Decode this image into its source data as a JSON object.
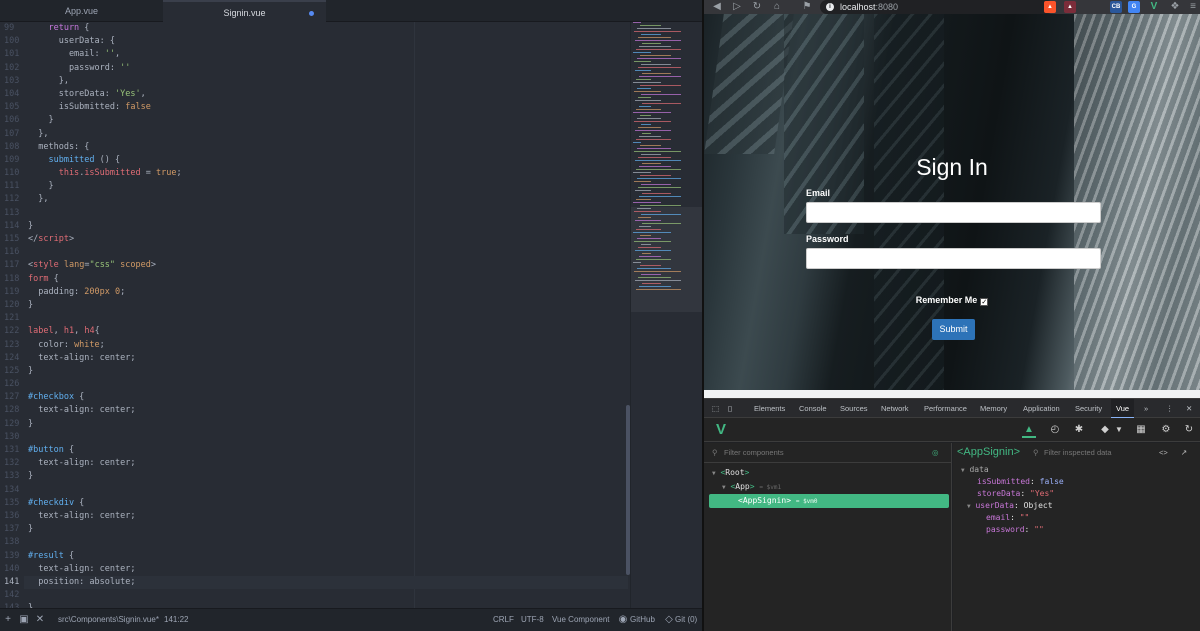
{
  "editor": {
    "tabs": [
      {
        "label": "App.vue"
      },
      {
        "label": "Signin.vue"
      }
    ],
    "line_numbers": [
      "99",
      "100",
      "101",
      "102",
      "103",
      "104",
      "105",
      "106",
      "107",
      "108",
      "109",
      "110",
      "111",
      "112",
      "113",
      "114",
      "115",
      "116",
      "117",
      "118",
      "119",
      "120",
      "121",
      "122",
      "123",
      "124",
      "125",
      "126",
      "127",
      "128",
      "129",
      "130",
      "131",
      "132",
      "133",
      "134",
      "135",
      "136",
      "137",
      "138",
      "139",
      "140",
      "141",
      "142",
      "143"
    ],
    "current_line": "141",
    "code_lines": [
      [
        [
          "kw",
          "    return"
        ],
        [
          "pl",
          " {"
        ]
      ],
      [
        [
          "pl",
          "      userData: {"
        ]
      ],
      [
        [
          "pl",
          "        email: "
        ],
        [
          "st",
          "''"
        ],
        [
          "pl",
          ","
        ]
      ],
      [
        [
          "pl",
          "        password: "
        ],
        [
          "st",
          "''"
        ]
      ],
      [
        [
          "pl",
          "      },"
        ]
      ],
      [
        [
          "pl",
          "      storeData: "
        ],
        [
          "st",
          "'Yes'"
        ],
        [
          "pl",
          ","
        ]
      ],
      [
        [
          "pl",
          "      isSubmitted: "
        ],
        [
          "nu",
          "false"
        ]
      ],
      [
        [
          "pl",
          "    }"
        ]
      ],
      [
        [
          "pl",
          "  },"
        ]
      ],
      [
        [
          "pl",
          "  methods: {"
        ]
      ],
      [
        [
          "fn",
          "    submitted"
        ],
        [
          "pl",
          " () {"
        ]
      ],
      [
        [
          "tg",
          "      this"
        ],
        [
          "pl",
          "."
        ],
        [
          "pr",
          "isSubmitted"
        ],
        [
          "pl",
          " = "
        ],
        [
          "nu",
          "true"
        ],
        [
          "pl",
          ";"
        ]
      ],
      [
        [
          "pl",
          "    }"
        ]
      ],
      [
        [
          "pl",
          "  },"
        ]
      ],
      [
        [
          "pl",
          ""
        ]
      ],
      [
        [
          "pl",
          "}"
        ]
      ],
      [
        [
          "pl",
          "</"
        ],
        [
          "tg",
          "script"
        ],
        [
          "pl",
          ">"
        ]
      ],
      [
        [
          "pl",
          ""
        ]
      ],
      [
        [
          "pl",
          "<"
        ],
        [
          "tg",
          "style"
        ],
        [
          "pl",
          " "
        ],
        [
          "at",
          "lang"
        ],
        [
          "pl",
          "="
        ],
        [
          "st",
          "\"css\""
        ],
        [
          "pl",
          " "
        ],
        [
          "at",
          "scoped"
        ],
        [
          "pl",
          ">"
        ]
      ],
      [
        [
          "tg",
          "form"
        ],
        [
          "pl",
          " {"
        ]
      ],
      [
        [
          "pl",
          "  padding: "
        ],
        [
          "nu",
          "200px 0"
        ],
        [
          "pl",
          ";"
        ]
      ],
      [
        [
          "pl",
          "}"
        ]
      ],
      [
        [
          "pl",
          ""
        ]
      ],
      [
        [
          "tg",
          "label"
        ],
        [
          "pl",
          ", "
        ],
        [
          "tg",
          "h1"
        ],
        [
          "pl",
          ", "
        ],
        [
          "tg",
          "h4"
        ],
        [
          "pl",
          "{"
        ]
      ],
      [
        [
          "pl",
          "  color: "
        ],
        [
          "nu",
          "white"
        ],
        [
          "pl",
          ";"
        ]
      ],
      [
        [
          "pl",
          "  text-align: center;"
        ]
      ],
      [
        [
          "pl",
          "}"
        ]
      ],
      [
        [
          "pl",
          ""
        ]
      ],
      [
        [
          "id",
          "#checkbox"
        ],
        [
          "pl",
          " {"
        ]
      ],
      [
        [
          "pl",
          "  text-align: center;"
        ]
      ],
      [
        [
          "pl",
          "}"
        ]
      ],
      [
        [
          "pl",
          ""
        ]
      ],
      [
        [
          "id",
          "#button"
        ],
        [
          "pl",
          " {"
        ]
      ],
      [
        [
          "pl",
          "  text-align: center;"
        ]
      ],
      [
        [
          "pl",
          "}"
        ]
      ],
      [
        [
          "pl",
          ""
        ]
      ],
      [
        [
          "id",
          "#checkdiv"
        ],
        [
          "pl",
          " {"
        ]
      ],
      [
        [
          "pl",
          "  text-align: center;"
        ]
      ],
      [
        [
          "pl",
          "}"
        ]
      ],
      [
        [
          "pl",
          ""
        ]
      ],
      [
        [
          "id",
          "#result"
        ],
        [
          "pl",
          " {"
        ]
      ],
      [
        [
          "pl",
          "  text-align: center;"
        ]
      ],
      [
        [
          "pl",
          "  position: absolute;"
        ]
      ],
      [
        [
          "pl",
          ""
        ]
      ],
      [
        [
          "pl",
          "}"
        ]
      ]
    ]
  },
  "statusbar": {
    "file_path": "src\\Components\\Signin.vue*",
    "cursor": "141:22",
    "line_ending": "CRLF",
    "encoding": "UTF-8",
    "grammar": "Vue Component",
    "github": "GitHub",
    "git": "Git (0)"
  },
  "browser": {
    "url_host": "localhost",
    "url_port": ":8080",
    "extensions": [
      "CB",
      "G"
    ],
    "page": {
      "title": "Sign In",
      "email_label": "Email",
      "password_label": "Password",
      "remember_label": "Remember Me",
      "remember_checked": "✓",
      "submit_label": "Submit"
    }
  },
  "devtools": {
    "tabs": [
      "Elements",
      "Console",
      "Sources",
      "Network",
      "Performance",
      "Memory",
      "Application",
      "Security",
      "Vue"
    ],
    "active_tab": "Vue",
    "more": "»",
    "vue": {
      "filter_components_placeholder": "Filter components",
      "filter_inspected_placeholder": "Filter inspected data",
      "selected_component": "<AppSignin>",
      "tree": {
        "root": "Root",
        "app": "App",
        "app_hint": "= $vm1",
        "signin": "AppSignin",
        "signin_hint": "= $vm0"
      },
      "data_section": "data",
      "props": [
        {
          "key": "isSubmitted",
          "value": "false",
          "kind": "bool"
        },
        {
          "key": "storeData",
          "value": "\"Yes\"",
          "kind": "str"
        },
        {
          "key": "userData",
          "value": "Object",
          "kind": "obj"
        },
        {
          "key": "email",
          "value": "\"\"",
          "kind": "str"
        },
        {
          "key": "password",
          "value": "\"\"",
          "kind": "str"
        }
      ]
    }
  },
  "colors": {
    "vue_green": "#42b883",
    "submit_blue": "#2d73b8",
    "editor_bg": "#282c34"
  }
}
